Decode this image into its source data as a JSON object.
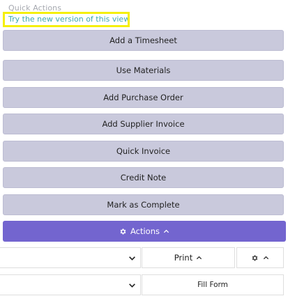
{
  "quick_actions": {
    "title": "Quick Actions",
    "new_version_link": "Try the new version of this view",
    "buttons": [
      {
        "label": "Add a Timesheet"
      },
      {
        "label": "Use Materials"
      },
      {
        "label": "Add Purchase Order"
      },
      {
        "label": "Add Supplier Invoice"
      },
      {
        "label": "Quick Invoice"
      },
      {
        "label": "Credit Note"
      },
      {
        "label": "Mark as Complete"
      }
    ],
    "actions_label": "Actions"
  },
  "footer": {
    "print_label": "Print",
    "fill_form_label": "Fill Form",
    "select_1_value": "",
    "select_2_value": ""
  },
  "colors": {
    "quick_action_bg": "#c9c9dc",
    "actions_bg": "#7365cf",
    "highlight_border": "#f5ef0a",
    "link_text": "#3fa9b0"
  },
  "icons": {
    "actions": "gear-icon",
    "actions_caret": "chevron-up-icon",
    "print_caret": "chevron-up-icon",
    "settings": "gear-icon",
    "settings_caret": "chevron-up-icon",
    "select_caret": "chevron-down-icon"
  }
}
